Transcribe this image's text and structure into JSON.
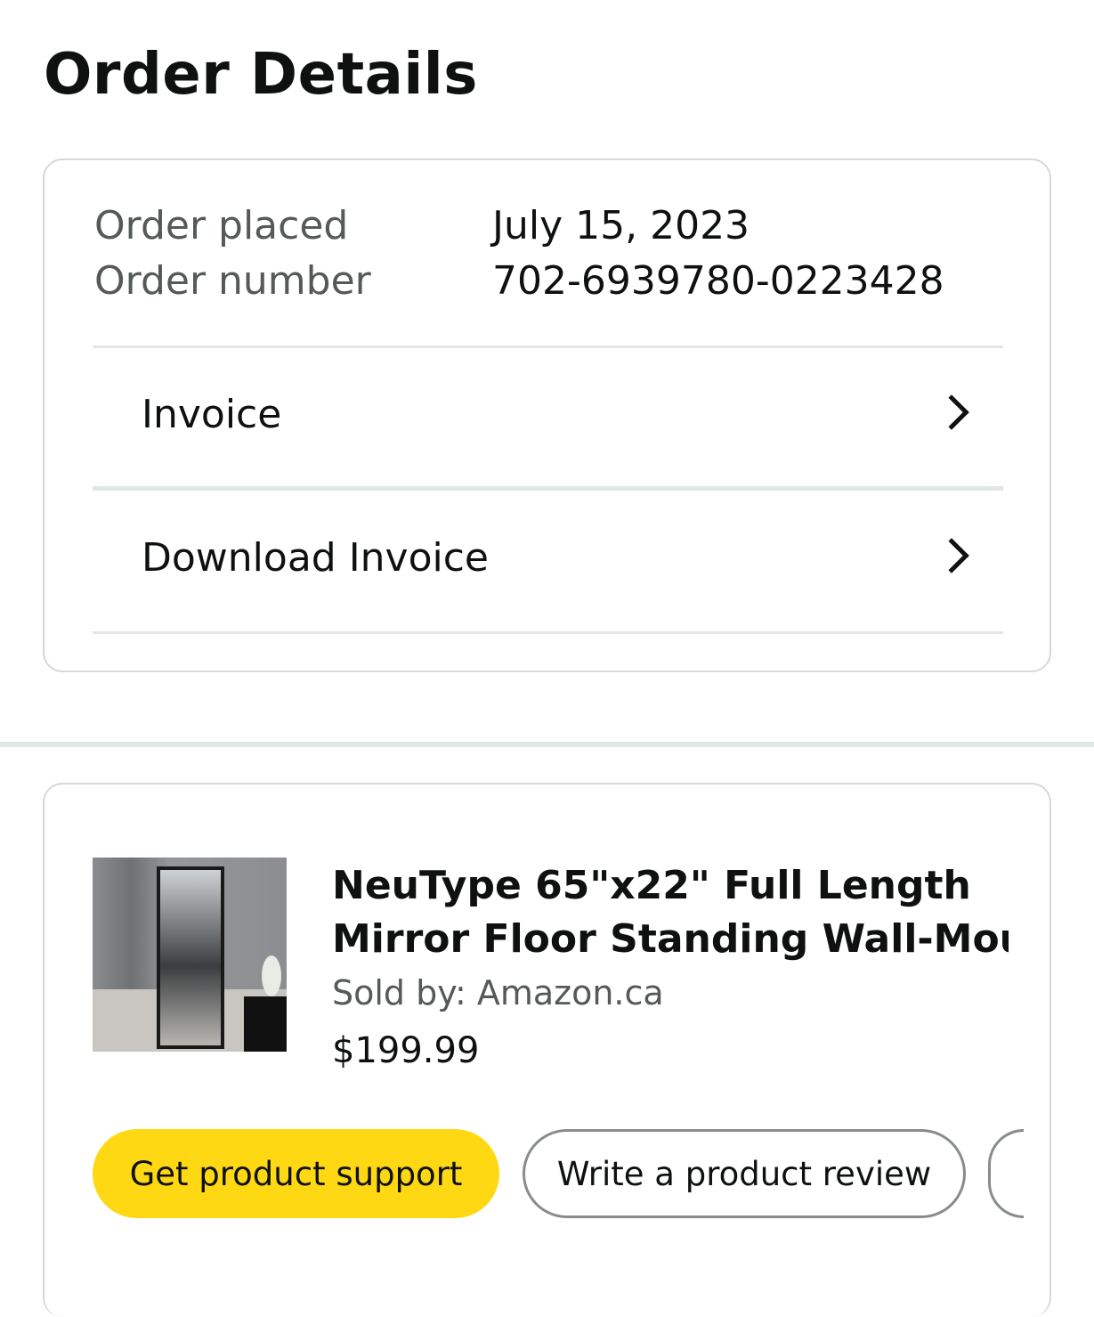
{
  "header": {
    "title": "Order Details"
  },
  "order": {
    "placed_label": "Order placed",
    "placed_value": "July 15, 2023",
    "number_label": "Order number",
    "number_value": "702-6939780-0223428"
  },
  "links": {
    "invoice": "Invoice",
    "download_invoice": "Download Invoice"
  },
  "product": {
    "title_line1": "NeuType 65\"x22\" Full Length",
    "title_line2": "Mirror Floor Standing Wall-Mou…",
    "sold_by": "Sold by: Amazon.ca",
    "price": "$199.99",
    "image_icon": "mirror-product-image"
  },
  "actions": {
    "support": "Get product support",
    "review": "Write a product review"
  },
  "colors": {
    "primary_button": "#ffd814",
    "border": "#d5d9d9",
    "muted_text": "#565959"
  }
}
